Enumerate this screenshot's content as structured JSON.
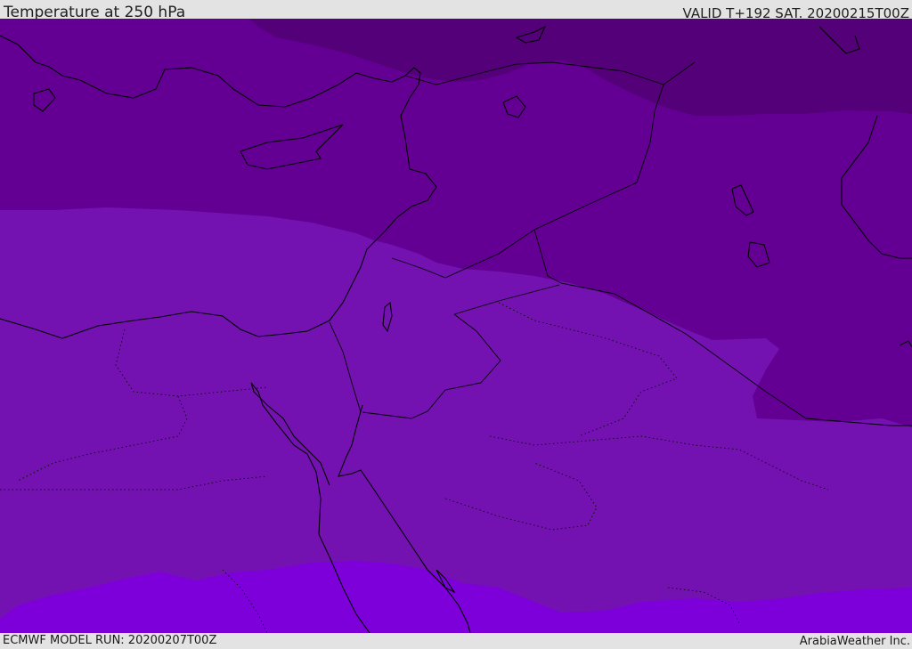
{
  "header": {
    "title": "Temperature at 250 hPa",
    "valid_time": "VALID T+192 SAT. 20200215T00Z"
  },
  "footer": {
    "model_run": "ECMWF MODEL RUN: 20200207T00Z",
    "credit": "ArabiaWeather Inc."
  },
  "map": {
    "type": "filled-contour",
    "colors": {
      "coldest": "#540079",
      "cold": "#630093",
      "mid": "#7312b0",
      "warm": "#7d00db",
      "coastline": "#000000",
      "background": "#e3e3e3"
    }
  }
}
